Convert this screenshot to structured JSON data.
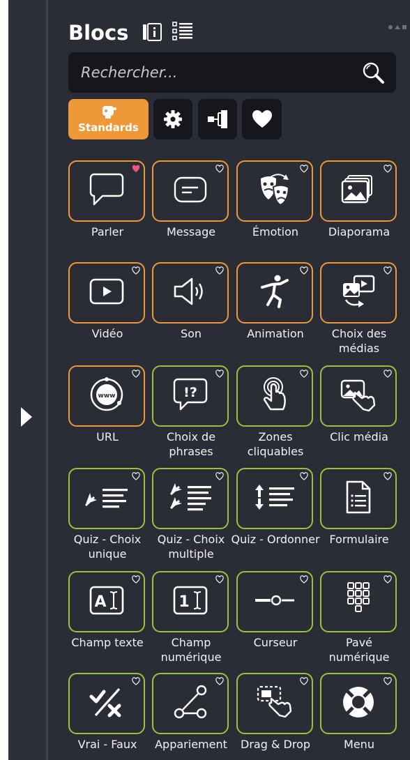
{
  "panel": {
    "title": "Blocs",
    "icons": [
      "info-icon",
      "list-view-icon",
      "window-dots-icon"
    ]
  },
  "search": {
    "placeholder": "Rechercher...",
    "icon": "search-icon"
  },
  "tabs": [
    {
      "label": "Standards",
      "icon": "robot-icon",
      "active": true
    },
    {
      "label": "",
      "icon": "gear-icon"
    },
    {
      "label": "",
      "icon": "hierarchy-icon"
    },
    {
      "label": "",
      "icon": "heart-icon"
    }
  ],
  "colors": {
    "accent_orange": "#ef9838",
    "accent_green": "#9bc23c",
    "panel_bg": "#2a2d36",
    "favorite": "#e85a7a"
  },
  "blocks": [
    {
      "label": "Parler",
      "icon": "speech-bubble-icon",
      "border": "orange",
      "favorite": true
    },
    {
      "label": "Message",
      "icon": "message-icon",
      "border": "orange",
      "favorite": false
    },
    {
      "label": "Émotion",
      "icon": "theater-masks-icon",
      "border": "orange",
      "favorite": false
    },
    {
      "label": "Diaporama",
      "icon": "slideshow-icon",
      "border": "orange",
      "favorite": false
    },
    {
      "label": "Vidéo",
      "icon": "video-play-icon",
      "border": "orange",
      "favorite": false
    },
    {
      "label": "Son",
      "icon": "speaker-icon",
      "border": "orange",
      "favorite": false
    },
    {
      "label": "Animation",
      "icon": "dancing-figure-icon",
      "border": "orange",
      "favorite": false
    },
    {
      "label": "Choix des médias",
      "icon": "media-choice-icon",
      "border": "orange",
      "favorite": false
    },
    {
      "label": "URL",
      "icon": "www-globe-icon",
      "border": "orange",
      "favorite": false
    },
    {
      "label": "Choix de phrases",
      "icon": "question-bubble-icon",
      "border": "green",
      "favorite": false
    },
    {
      "label": "Zones cliquables",
      "icon": "tap-finger-icon",
      "border": "green",
      "favorite": false
    },
    {
      "label": "Clic média",
      "icon": "hand-on-image-icon",
      "border": "green",
      "favorite": false
    },
    {
      "label": "Quiz - Choix unique",
      "icon": "single-choice-icon",
      "border": "green",
      "favorite": false
    },
    {
      "label": "Quiz - Choix multiple",
      "icon": "multiple-choice-icon",
      "border": "green",
      "favorite": false
    },
    {
      "label": "Quiz - Ordonner",
      "icon": "order-icon",
      "border": "green",
      "favorite": false
    },
    {
      "label": "Formulaire",
      "icon": "form-document-icon",
      "border": "green",
      "favorite": false
    },
    {
      "label": "Champ texte",
      "icon": "text-field-icon",
      "border": "green",
      "favorite": false
    },
    {
      "label": "Champ numérique",
      "icon": "number-field-icon",
      "border": "green",
      "favorite": false
    },
    {
      "label": "Curseur",
      "icon": "slider-icon",
      "border": "green",
      "favorite": false
    },
    {
      "label": "Pavé numérique",
      "icon": "keypad-icon",
      "border": "green",
      "favorite": false
    },
    {
      "label": "Vrai - Faux",
      "icon": "true-false-icon",
      "border": "green",
      "favorite": false
    },
    {
      "label": "Appariement",
      "icon": "matching-icon",
      "border": "green",
      "favorite": false
    },
    {
      "label": "Drag & Drop",
      "icon": "drag-drop-icon",
      "border": "green",
      "favorite": false
    },
    {
      "label": "Menu",
      "icon": "lifebuoy-icon",
      "border": "green",
      "favorite": false
    }
  ]
}
